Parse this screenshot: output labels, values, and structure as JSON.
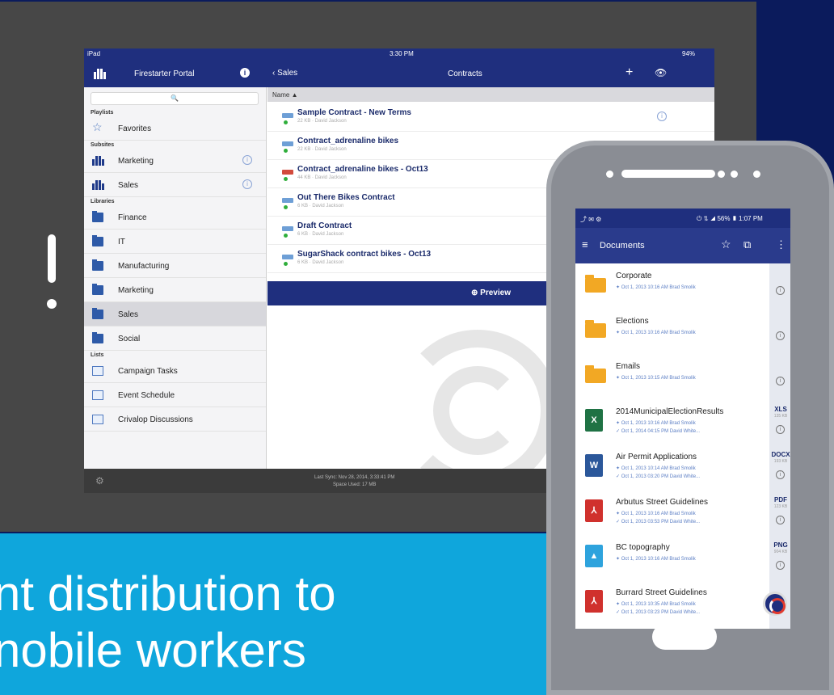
{
  "tagline": {
    "line1": "nt distribution to",
    "line2": "nobile workers"
  },
  "tablet": {
    "status": {
      "carrier": "iPad",
      "time": "3:30 PM",
      "battery": "94%"
    },
    "nav": {
      "portal_title": "Firestarter Portal",
      "back_label": "Sales",
      "list_title": "Contracts",
      "plus": "+",
      "eye": "👁",
      "info": "i"
    },
    "sidebar": {
      "search_icon": "🔍",
      "sections": {
        "playlists": "Playlists",
        "subsites": "Subsites",
        "libraries": "Libraries",
        "lists": "Lists"
      },
      "playlists": [
        {
          "label": "Favorites",
          "icon": "star-icon"
        }
      ],
      "subsites": [
        {
          "label": "Marketing",
          "icon": "people-icon"
        },
        {
          "label": "Sales",
          "icon": "people-icon"
        }
      ],
      "libraries": [
        {
          "label": "Finance"
        },
        {
          "label": "IT"
        },
        {
          "label": "Manufacturing"
        },
        {
          "label": "Marketing"
        },
        {
          "label": "Sales"
        },
        {
          "label": "Social"
        }
      ],
      "lists": [
        {
          "label": "Campaign Tasks"
        },
        {
          "label": "Event Schedule"
        },
        {
          "label": "Crivalop Discussions"
        }
      ]
    },
    "list": {
      "header": "Name ▲",
      "rows": [
        {
          "title": "Sample Contract - New Terms",
          "meta": "22 KB · David Jackson"
        },
        {
          "title": "Contract_adrenaline bikes",
          "meta": "22 KB · David Jackson"
        },
        {
          "title": "Contract_adrenaline bikes - Oct13",
          "meta": "44 KB · David Jackson"
        },
        {
          "title": "Out There Bikes Contract",
          "meta": "6 KB · David Jackson"
        },
        {
          "title": "Draft Contract",
          "meta": "6 KB · David Jackson"
        },
        {
          "title": "SugarShack contract bikes - Oct13",
          "meta": "6 KB · David Jackson"
        }
      ],
      "preview_label": "⊕ Preview"
    },
    "footer": {
      "gear": "⚙",
      "last_sync": "Last Sync: Nov 28, 2014, 3:33:41 PM",
      "space": "Space Used: 17 MB"
    }
  },
  "phone": {
    "status": {
      "left": "⤴ ✉ ⚙",
      "right": "⏻ ⇅ ◢ 56% ▮ 1:07 PM"
    },
    "nav": {
      "menu": "≡",
      "title": "Documents",
      "star": "☆",
      "pic": "⧉",
      "more": "⋮"
    },
    "rows": [
      {
        "type": "folder",
        "title": "Corporate",
        "meta": "✦ Oct 1, 2013 10:16 AM   Brad Smolik",
        "meta2": "",
        "ext": "",
        "size": ""
      },
      {
        "type": "folder",
        "title": "Elections",
        "meta": "✦ Oct 1, 2013 10:16 AM   Brad Smolik",
        "meta2": "",
        "ext": "",
        "size": ""
      },
      {
        "type": "folder",
        "title": "Emails",
        "meta": "✦ Oct 1, 2013 10:15 AM   Brad Smolik",
        "meta2": "",
        "ext": "",
        "size": ""
      },
      {
        "type": "xls",
        "title": "2014MunicipalElectionResults",
        "meta": "✦ Oct 1, 2013 10:16 AM   Brad Smolik",
        "meta2": "✓ Oct 1, 2014 04:15 PM   David White...",
        "ext": "XLS",
        "size": "135 KB"
      },
      {
        "type": "docx",
        "title": "Air Permit Applications",
        "meta": "✦ Oct 1, 2013 10:14 AM   Brad Smolik",
        "meta2": "✓ Oct 1, 2013 03:20 PM   David White...",
        "ext": "DOCX",
        "size": "193 KB"
      },
      {
        "type": "pdf",
        "title": "Arbutus Street Guidelines",
        "meta": "✦ Oct 1, 2013 10:16 AM   Brad Smolik",
        "meta2": "✓ Oct 1, 2013 03:53 PM   David White...",
        "ext": "PDF",
        "size": "123 KB"
      },
      {
        "type": "png",
        "title": "BC topography",
        "meta": "✦ Oct 1, 2013 10:16 AM   Brad Smolik",
        "meta2": "",
        "ext": "PNG",
        "size": "904 KB"
      },
      {
        "type": "pdf",
        "title": "Burrard Street Guidelines",
        "meta": "✦ Oct 1, 2013 10:35 AM   Brad Smolik",
        "meta2": "✓ Oct 1, 2013 03:23 PM   David White...",
        "ext": "",
        "size": ""
      }
    ],
    "info": "i"
  },
  "colors": {
    "navy": "#1f2f7e",
    "bg_dark": "#0b1b5c",
    "bg_light": "#0fa6dc",
    "folder": "#f2a824",
    "xls": "#1f7244",
    "docx": "#2b579a",
    "pdf": "#d0312d",
    "png": "#2ea3dd"
  }
}
